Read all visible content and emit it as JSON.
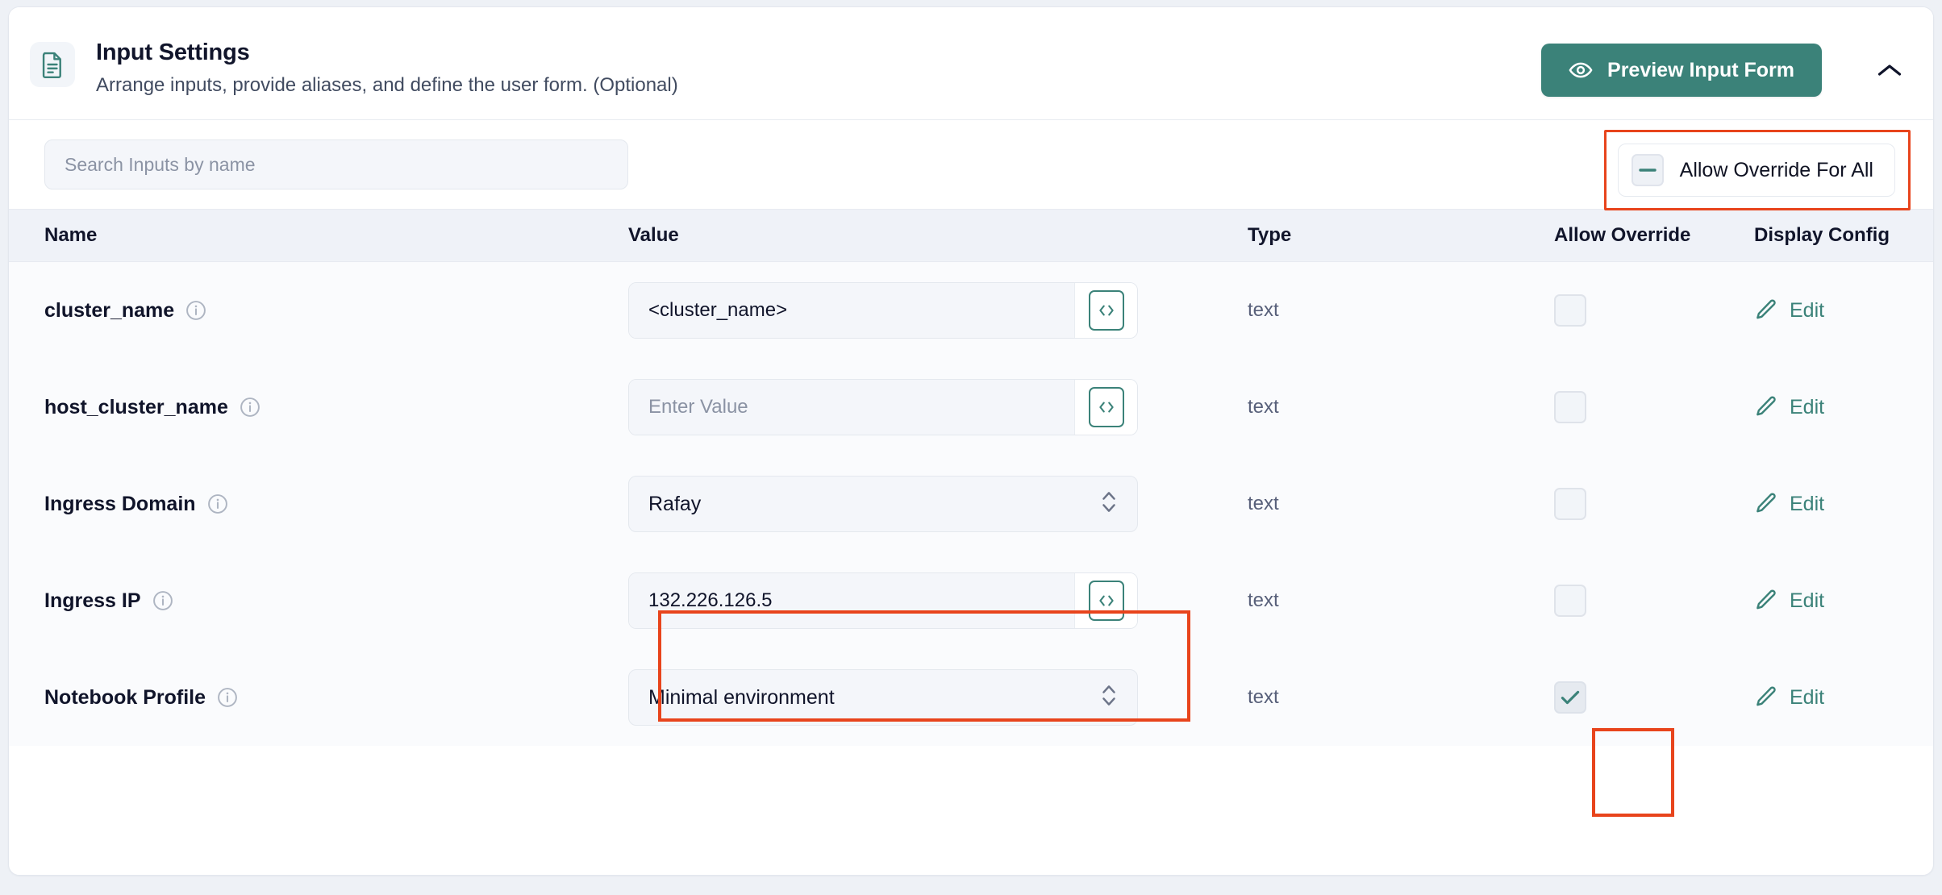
{
  "header": {
    "title": "Input Settings",
    "subtitle": "Arrange inputs, provide aliases, and define the user form. (Optional)",
    "icon": "document-icon",
    "preview_button_label": "Preview Input Form",
    "preview_button_icon": "eye-icon",
    "collapse_icon": "chevron-up-icon"
  },
  "toolbar": {
    "search_placeholder": "Search Inputs by name",
    "search_value": "",
    "override_all_label": "Allow Override For All",
    "override_all_state": "indeterminate"
  },
  "table": {
    "headers": {
      "name": "Name",
      "value": "Value",
      "type": "Type",
      "allow_override": "Allow Override",
      "display_config": "Display Config"
    },
    "edit_label": "Edit",
    "edit_icon": "pencil-icon",
    "code_icon": "code-brackets-icon",
    "info_icon": "info-circle-icon",
    "rows": [
      {
        "name": "cluster_name",
        "control": "input",
        "value": "<cluster_name>",
        "placeholder": "",
        "type": "text",
        "allow_override": false,
        "display_config": "Edit"
      },
      {
        "name": "host_cluster_name",
        "control": "input",
        "value": "",
        "placeholder": "Enter Value",
        "type": "text",
        "allow_override": false,
        "display_config": "Edit"
      },
      {
        "name": "Ingress Domain",
        "control": "select",
        "value": "Rafay",
        "placeholder": "",
        "type": "text",
        "allow_override": false,
        "display_config": "Edit"
      },
      {
        "name": "Ingress IP",
        "control": "input",
        "value": "132.226.126.5",
        "placeholder": "",
        "type": "text",
        "allow_override": false,
        "display_config": "Edit"
      },
      {
        "name": "Notebook Profile",
        "control": "select",
        "value": "Minimal environment",
        "placeholder": "",
        "type": "text",
        "allow_override": true,
        "display_config": "Edit"
      }
    ]
  },
  "annotations": [
    {
      "name": "highlight-allow-override-for-all",
      "color": "#e8441c"
    },
    {
      "name": "highlight-ingress-ip-value",
      "color": "#e8441c"
    },
    {
      "name": "highlight-notebook-profile-override-checkbox",
      "color": "#e8441c"
    }
  ],
  "colors": {
    "accent": "#3b8279",
    "annotation": "#e8441c",
    "header_row_bg": "#eff2f8",
    "row_bg": "#fafbfd"
  }
}
